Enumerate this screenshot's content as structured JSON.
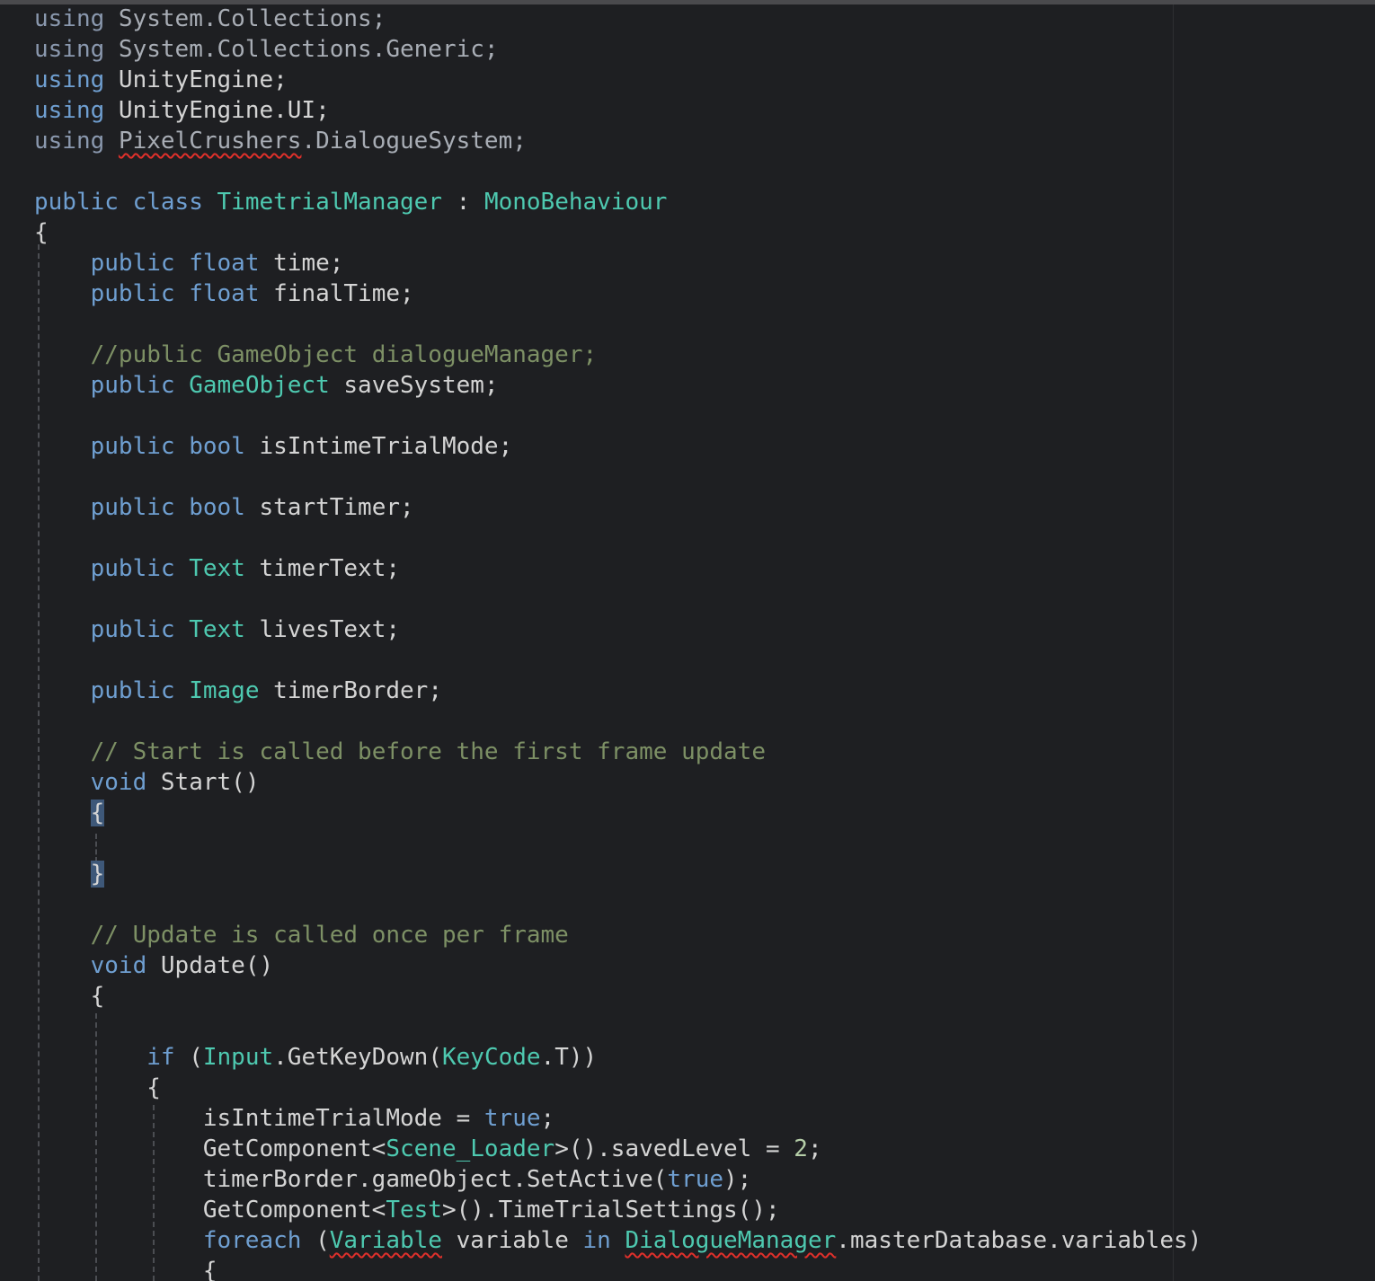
{
  "editor": {
    "lines": [
      [
        {
          "t": "using",
          "c": "kw-dim"
        },
        {
          "t": " System.Collections;",
          "c": "dim"
        }
      ],
      [
        {
          "t": "using",
          "c": "kw-dim"
        },
        {
          "t": " System.Collections.Generic;",
          "c": "dim"
        }
      ],
      [
        {
          "t": "using",
          "c": "kw"
        },
        {
          "t": " UnityEngine;",
          "c": "pl"
        }
      ],
      [
        {
          "t": "using",
          "c": "kw"
        },
        {
          "t": " UnityEngine.UI;",
          "c": "pl"
        }
      ],
      [
        {
          "t": "using",
          "c": "kw-dim"
        },
        {
          "t": " ",
          "c": "dim"
        },
        {
          "t": "PixelCrushers",
          "c": "dim",
          "err": true
        },
        {
          "t": ".DialogueSystem;",
          "c": "dim"
        }
      ],
      [],
      [
        {
          "t": "public",
          "c": "kw"
        },
        {
          "t": " ",
          "c": "pl"
        },
        {
          "t": "class",
          "c": "kw"
        },
        {
          "t": " ",
          "c": "pl"
        },
        {
          "t": "TimetrialManager",
          "c": "ty"
        },
        {
          "t": " : ",
          "c": "pl"
        },
        {
          "t": "MonoBehaviour",
          "c": "ty"
        }
      ],
      [
        {
          "t": "{",
          "c": "pl"
        }
      ],
      [
        {
          "t": "    ",
          "c": "pl"
        },
        {
          "t": "public",
          "c": "kw"
        },
        {
          "t": " ",
          "c": "pl"
        },
        {
          "t": "float",
          "c": "kw"
        },
        {
          "t": " time;",
          "c": "pl"
        }
      ],
      [
        {
          "t": "    ",
          "c": "pl"
        },
        {
          "t": "public",
          "c": "kw"
        },
        {
          "t": " ",
          "c": "pl"
        },
        {
          "t": "float",
          "c": "kw"
        },
        {
          "t": " finalTime;",
          "c": "pl"
        }
      ],
      [],
      [
        {
          "t": "    ",
          "c": "pl"
        },
        {
          "t": "//public GameObject dialogueManager;",
          "c": "cm"
        }
      ],
      [
        {
          "t": "    ",
          "c": "pl"
        },
        {
          "t": "public",
          "c": "kw"
        },
        {
          "t": " ",
          "c": "pl"
        },
        {
          "t": "GameObject",
          "c": "ty"
        },
        {
          "t": " saveSystem;",
          "c": "pl"
        }
      ],
      [],
      [
        {
          "t": "    ",
          "c": "pl"
        },
        {
          "t": "public",
          "c": "kw"
        },
        {
          "t": " ",
          "c": "pl"
        },
        {
          "t": "bool",
          "c": "kw"
        },
        {
          "t": " isIntimeTrialMode;",
          "c": "pl"
        }
      ],
      [],
      [
        {
          "t": "    ",
          "c": "pl"
        },
        {
          "t": "public",
          "c": "kw"
        },
        {
          "t": " ",
          "c": "pl"
        },
        {
          "t": "bool",
          "c": "kw"
        },
        {
          "t": " startTimer;",
          "c": "pl"
        }
      ],
      [],
      [
        {
          "t": "    ",
          "c": "pl"
        },
        {
          "t": "public",
          "c": "kw"
        },
        {
          "t": " ",
          "c": "pl"
        },
        {
          "t": "Text",
          "c": "ty"
        },
        {
          "t": " timerText;",
          "c": "pl"
        }
      ],
      [],
      [
        {
          "t": "    ",
          "c": "pl"
        },
        {
          "t": "public",
          "c": "kw"
        },
        {
          "t": " ",
          "c": "pl"
        },
        {
          "t": "Text",
          "c": "ty"
        },
        {
          "t": " livesText;",
          "c": "pl"
        }
      ],
      [],
      [
        {
          "t": "    ",
          "c": "pl"
        },
        {
          "t": "public",
          "c": "kw"
        },
        {
          "t": " ",
          "c": "pl"
        },
        {
          "t": "Image",
          "c": "ty"
        },
        {
          "t": " timerBorder;",
          "c": "pl"
        }
      ],
      [],
      [
        {
          "t": "    ",
          "c": "pl"
        },
        {
          "t": "// Start is called before the first frame update",
          "c": "cm"
        }
      ],
      [
        {
          "t": "    ",
          "c": "pl"
        },
        {
          "t": "void",
          "c": "kw"
        },
        {
          "t": " Start()",
          "c": "pl"
        }
      ],
      [
        {
          "t": "    ",
          "c": "pl"
        },
        {
          "t": "{",
          "c": "pl",
          "hl": true
        }
      ],
      [],
      [
        {
          "t": "    ",
          "c": "pl"
        },
        {
          "t": "}",
          "c": "pl",
          "hl": true
        }
      ],
      [],
      [
        {
          "t": "    ",
          "c": "pl"
        },
        {
          "t": "// Update is called once per frame",
          "c": "cm"
        }
      ],
      [
        {
          "t": "    ",
          "c": "pl"
        },
        {
          "t": "void",
          "c": "kw"
        },
        {
          "t": " Update()",
          "c": "pl"
        }
      ],
      [
        {
          "t": "    {",
          "c": "pl"
        }
      ],
      [],
      [
        {
          "t": "        ",
          "c": "pl"
        },
        {
          "t": "if",
          "c": "kw"
        },
        {
          "t": " (",
          "c": "pl"
        },
        {
          "t": "Input",
          "c": "ty"
        },
        {
          "t": ".GetKeyDown(",
          "c": "pl"
        },
        {
          "t": "KeyCode",
          "c": "ty"
        },
        {
          "t": ".T))",
          "c": "pl"
        }
      ],
      [
        {
          "t": "        {",
          "c": "pl"
        }
      ],
      [
        {
          "t": "            isIntimeTrialMode = ",
          "c": "pl"
        },
        {
          "t": "true",
          "c": "kw"
        },
        {
          "t": ";",
          "c": "pl"
        }
      ],
      [
        {
          "t": "            GetComponent<",
          "c": "pl"
        },
        {
          "t": "Scene_Loader",
          "c": "ty"
        },
        {
          "t": ">().savedLevel = ",
          "c": "pl"
        },
        {
          "t": "2",
          "c": "nm"
        },
        {
          "t": ";",
          "c": "pl"
        }
      ],
      [
        {
          "t": "            timerBorder.gameObject.SetActive(",
          "c": "pl"
        },
        {
          "t": "true",
          "c": "kw"
        },
        {
          "t": ");",
          "c": "pl"
        }
      ],
      [
        {
          "t": "            GetComponent<",
          "c": "pl"
        },
        {
          "t": "Test",
          "c": "ty"
        },
        {
          "t": ">().TimeTrialSettings();",
          "c": "pl"
        }
      ],
      [
        {
          "t": "            ",
          "c": "pl"
        },
        {
          "t": "foreach",
          "c": "kw"
        },
        {
          "t": " (",
          "c": "pl"
        },
        {
          "t": "Variable",
          "c": "ty",
          "err": true
        },
        {
          "t": " variable ",
          "c": "pl"
        },
        {
          "t": "in",
          "c": "kw"
        },
        {
          "t": " ",
          "c": "pl"
        },
        {
          "t": "DialogueManager",
          "c": "ty",
          "err": true
        },
        {
          "t": ".masterDatabase.variables)",
          "c": "pl"
        }
      ],
      [
        {
          "t": "            {",
          "c": "pl"
        }
      ]
    ]
  }
}
